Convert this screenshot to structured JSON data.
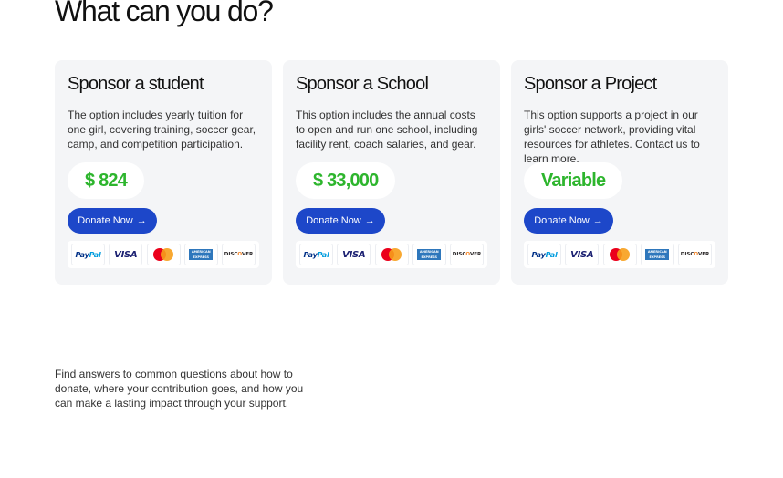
{
  "header": {
    "title": "What can you do?"
  },
  "cards": [
    {
      "title": "Sponsor a student",
      "description": "The option includes yearly tuition for one girl, covering training, soccer gear, camp, and competition participation.",
      "price": "$ 824",
      "button_label": "Donate Now",
      "button_icon": "arrow-right-icon"
    },
    {
      "title": "Sponsor a School",
      "description": "This option includes the annual costs to open and run one school, including facility rent, coach salaries, and gear.",
      "price": "$ 33,000",
      "button_label": "Donate Now",
      "button_icon": "arrow-right-icon"
    },
    {
      "title": "Sponsor a Project",
      "description": "This option supports a project in our girls' soccer network, providing vital resources for athletes. Contact us to learn more.",
      "price": "Variable",
      "button_label": "Donate Now",
      "button_icon": "arrow-right-icon"
    }
  ],
  "payment_methods": [
    "PayPal",
    "VISA",
    "Mastercard",
    "American Express",
    "DISCOVER"
  ],
  "faq": {
    "intro": "Find answers to common questions about how to donate, where your contribution goes, and how you can make a lasting impact through your support."
  },
  "colors": {
    "accent": "#1d47c9",
    "price": "#2db52d",
    "card_bg": "#f4f5f7"
  }
}
